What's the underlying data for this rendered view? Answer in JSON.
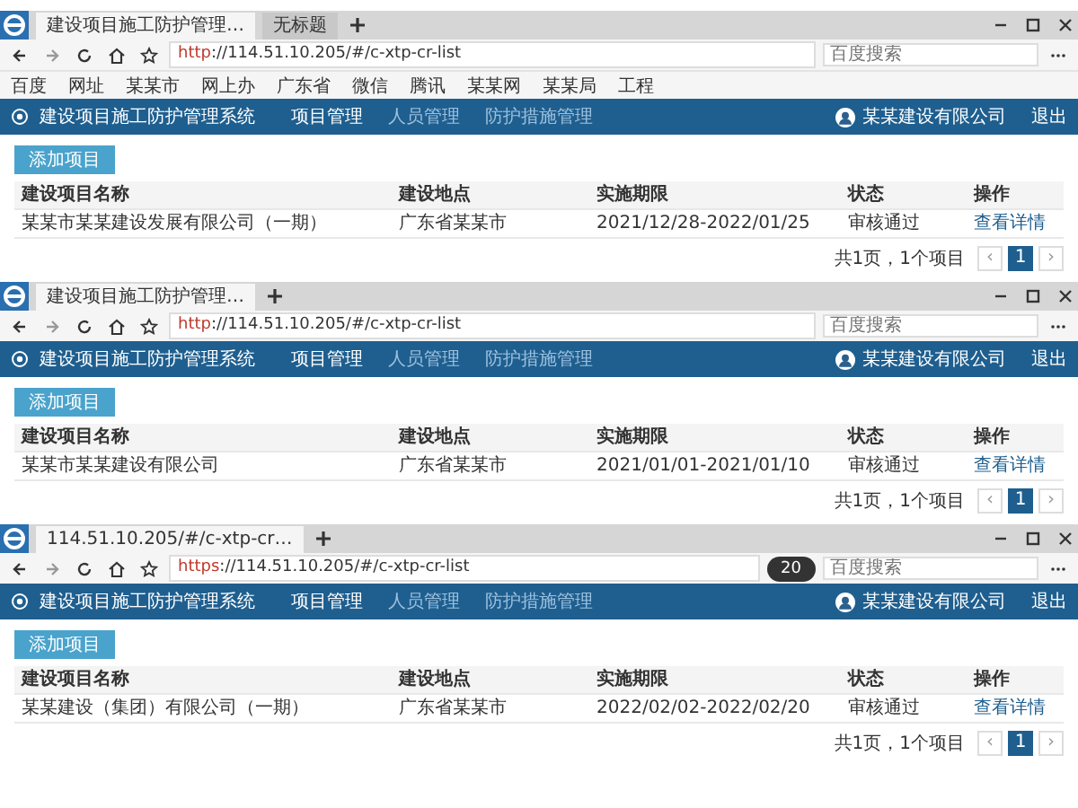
{
  "panels": [
    {
      "tabs": [
        {
          "title": "建设项目施工防护管理…",
          "selected": true
        },
        {
          "title": "无标题",
          "selected": false
        }
      ],
      "url_scheme": "http",
      "url_rest": "://114.51.10.205/#/c-xtp-cr-list",
      "search": {
        "placeholder": "百度搜索"
      },
      "bookmarks": [
        "百度",
        "网址",
        "某某市",
        "网上办",
        "广东省",
        "微信",
        "腾讯",
        "某某网",
        "某某局",
        "工程"
      ],
      "nav": {
        "title": "建设项目施工防护管理系统",
        "items": [
          {
            "label": "项目管理",
            "selected": true
          },
          {
            "label": "人员管理",
            "selected": false
          },
          {
            "label": "防护措施管理",
            "selected": false
          }
        ],
        "user": "某某建设有限公司",
        "logout": "退出"
      },
      "add_button": "添加项目",
      "table": {
        "columns": [
          "建设项目名称",
          "建设地点",
          "实施期限",
          "状态",
          "操作"
        ],
        "rows": [
          {
            "cells": [
              "某某市某某建设发展有限公司（一期）",
              "广东省某某市",
              "2021/12/28-2022/01/25",
              "审核通过"
            ],
            "action": "查看详情"
          }
        ]
      },
      "pagination": {
        "summary": "共1页，1个项目",
        "prev": "‹",
        "next": "›",
        "pages": [
          {
            "label": "1",
            "selected": true
          }
        ]
      }
    },
    {
      "tabs": [
        {
          "title": "建设项目施工防护管理…",
          "selected": true
        }
      ],
      "url_scheme": "http",
      "url_rest": "://114.51.10.205/#/c-xtp-cr-list",
      "search": {
        "placeholder": "百度搜索"
      },
      "nav": {
        "title": "建设项目施工防护管理系统",
        "items": [
          {
            "label": "项目管理",
            "selected": true
          },
          {
            "label": "人员管理",
            "selected": false
          },
          {
            "label": "防护措施管理",
            "selected": false
          }
        ],
        "user": "某某建设有限公司",
        "logout": "退出"
      },
      "add_button": "添加项目",
      "table": {
        "columns": [
          "建设项目名称",
          "建设地点",
          "实施期限",
          "状态",
          "操作"
        ],
        "rows": [
          {
            "cells": [
              "某某市某某建设有限公司",
              "广东省某某市",
              "2021/01/01-2021/01/10",
              "审核通过"
            ],
            "action": "查看详情"
          }
        ]
      },
      "pagination": {
        "summary": "共1页，1个项目",
        "prev": "‹",
        "next": "›",
        "pages": [
          {
            "label": "1",
            "selected": true
          }
        ]
      }
    },
    {
      "tabs": [
        {
          "title": "114.51.10.205/#/c-xtp-cr…",
          "selected": true
        }
      ],
      "url_scheme": "https",
      "url_rest": "://114.51.10.205/#/c-xtp-cr-list",
      "search": {
        "placeholder": "百度搜索"
      },
      "zoom_badge": "20",
      "nav": {
        "title": "建设项目施工防护管理系统",
        "items": [
          {
            "label": "项目管理",
            "selected": true
          },
          {
            "label": "人员管理",
            "selected": false
          },
          {
            "label": "防护措施管理",
            "selected": false
          }
        ],
        "user": "某某建设有限公司",
        "logout": "退出"
      },
      "add_button": "添加项目",
      "table": {
        "columns": [
          "建设项目名称",
          "建设地点",
          "实施期限",
          "状态",
          "操作"
        ],
        "rows": [
          {
            "cells": [
              "某某建设（集团）有限公司（一期）",
              "广东省某某市",
              "2022/02/02-2022/02/20",
              "审核通过"
            ],
            "action": "查看详情"
          }
        ]
      },
      "pagination": {
        "summary": "共1页，1个项目",
        "prev": "‹",
        "next": "›",
        "pages": [
          {
            "label": "1",
            "selected": true
          }
        ]
      }
    }
  ]
}
